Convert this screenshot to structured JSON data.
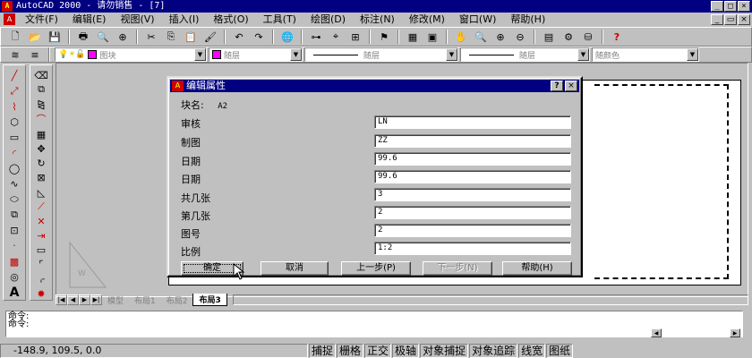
{
  "app": {
    "title": "AutoCAD 2000 - 请勿销售 - [7]"
  },
  "menu": [
    "文件(F)",
    "编辑(E)",
    "视图(V)",
    "插入(I)",
    "格式(O)",
    "工具(T)",
    "绘图(D)",
    "标注(N)",
    "修改(M)",
    "窗口(W)",
    "帮助(H)"
  ],
  "props": {
    "layer_value": "图块",
    "color_value": "随层",
    "linetype_value": "随层",
    "lineweight_value": "随层",
    "plotstyle_value": "随颜色"
  },
  "dialog": {
    "title": "编辑属性",
    "block_label": "块名:",
    "block_name": "A2",
    "rows": [
      {
        "label": "审核",
        "value": "LN"
      },
      {
        "label": "制图",
        "value": "ZZ"
      },
      {
        "label": "日期",
        "value": "99.6"
      },
      {
        "label": "日期",
        "value": "99.6"
      },
      {
        "label": "共几张",
        "value": "3"
      },
      {
        "label": "第几张",
        "value": "2"
      },
      {
        "label": "图号",
        "value": "2"
      },
      {
        "label": "比例",
        "value": "1:2"
      }
    ],
    "buttons": {
      "ok": "确定",
      "cancel": "取消",
      "prev": "上一步(P)",
      "next": "下一步(N)",
      "help": "帮助(H)"
    }
  },
  "layout_tabs": [
    "模型",
    "布局1",
    "布局2",
    "布局3"
  ],
  "command": {
    "line1": "命令:",
    "line2": "命令:"
  },
  "status": {
    "coords": "-148.9, 109.5, 0.0",
    "toggles": [
      "捕捉",
      "栅格",
      "正交",
      "极轴",
      "对象捕捉",
      "对象追踪",
      "线宽",
      "图纸"
    ]
  },
  "colors": {
    "titlebar": "#000080",
    "layer_swatch": "#ff00ff",
    "paper": "#ffffff"
  }
}
